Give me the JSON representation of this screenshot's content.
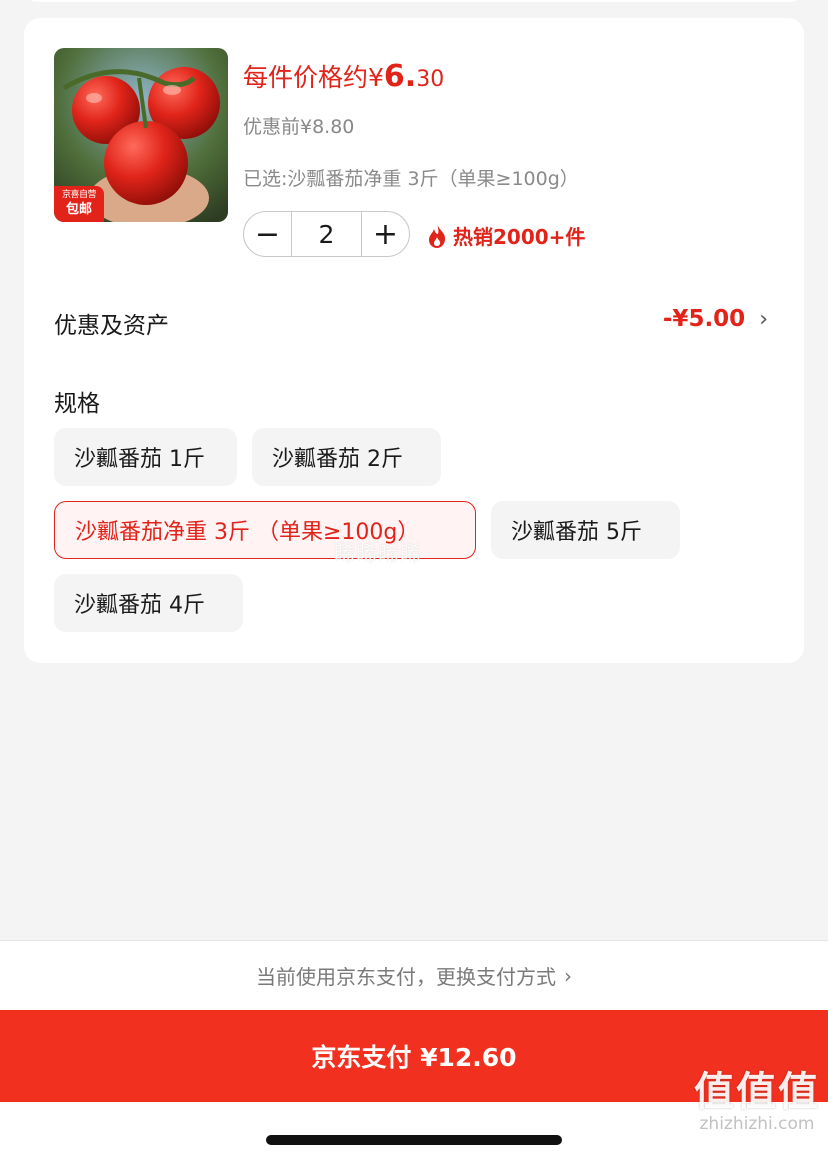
{
  "product": {
    "badge_top": "京喜自营",
    "badge_bottom": "包邮",
    "price_prefix": "每件价格约",
    "price_currency": "¥",
    "price_int": "6.",
    "price_dec": "30",
    "original_price": "优惠前¥8.80",
    "selected_spec": "已选:沙瓢番茄净重 3斤（单果≥100g）",
    "quantity": "2",
    "minus_label": "−",
    "plus_label": "+",
    "hot_sales": "热销2000+件"
  },
  "discount": {
    "label": "优惠及资产",
    "value": "-¥5.00",
    "chevron": "›"
  },
  "specs": {
    "label": "规格",
    "options": [
      "沙瓤番茄 1斤",
      "沙瓤番茄 2斤",
      "沙瓤番茄净重 3斤 （单果≥100g）",
      "沙瓤番茄 5斤",
      "沙瓤番茄 4斤"
    ],
    "selected_index": 2,
    "overlay_watermark": "晞晞晞晞"
  },
  "payment": {
    "switch_text": "当前使用京东支付，更换支付方式",
    "switch_chevron": "›",
    "pay_button": "京东支付 ¥12.60"
  },
  "watermark": {
    "logo_text": "值值值",
    "site": "zhizhizhi.com"
  },
  "colors": {
    "accent": "#e2231a",
    "pay_button": "#f2301f",
    "background": "#f4f4f4"
  },
  "icons": {
    "hot": "flame-icon",
    "chevron": "chevron-right-icon"
  }
}
